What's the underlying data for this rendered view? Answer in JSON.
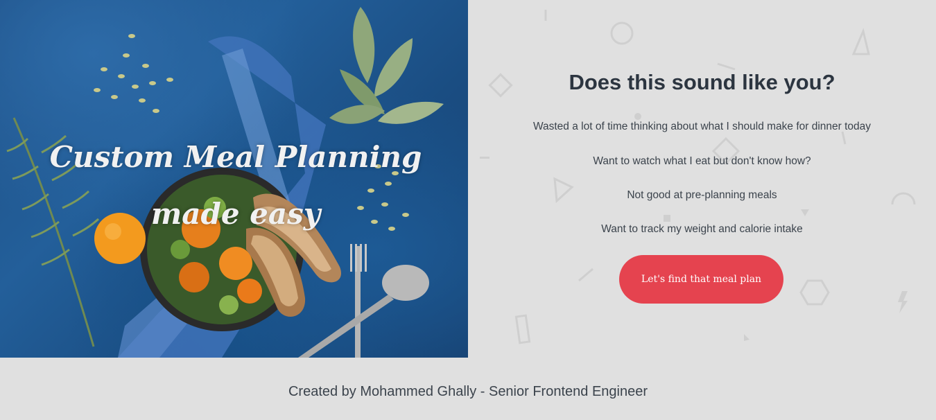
{
  "hero": {
    "title": "Custom Meal Planning made easy"
  },
  "questionnaire": {
    "heading": "Does this sound like you?",
    "pain_points": [
      "Wasted a lot of time thinking about what I should make for dinner today",
      "Want to watch what I eat but don't know how?",
      "Not good at pre-planning meals",
      "Want to track my weight and calorie intake"
    ],
    "cta_label": "Let's find that meal plan"
  },
  "footer": {
    "credit": "Created by Mohammed Ghally - Senior Frontend Engineer"
  },
  "colors": {
    "accent": "#e5434f",
    "panel_bg": "#e0e0e0",
    "heading_text": "#2c3540",
    "body_text": "#3b434c"
  }
}
